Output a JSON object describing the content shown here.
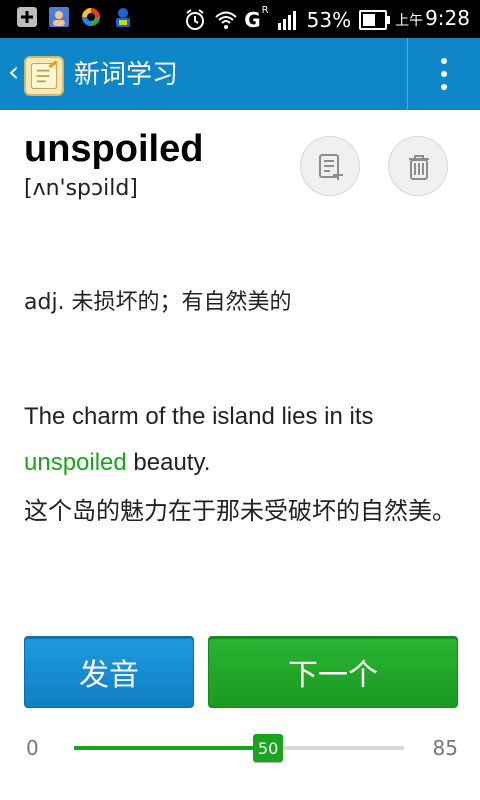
{
  "status_bar": {
    "battery_percent": "53%",
    "time_prefix": "上午",
    "time": "9:28",
    "network": "G",
    "network_sub": "R"
  },
  "app_bar": {
    "title": "新词学习"
  },
  "word": {
    "headword": "unspoiled",
    "phonetic": "[ʌn'spɔild]",
    "definition": "adj. 未损坏的；有自然美的",
    "example": {
      "prefix": "The charm of the island lies in its ",
      "highlight": "unspoiled",
      "suffix": " beauty.",
      "translation": "这个岛的魅力在于那未受破坏的自然美。"
    }
  },
  "actions": {
    "pronounce_label": "发音",
    "next_label": "下一个"
  },
  "slider": {
    "min": "0",
    "max": "85",
    "value": "50"
  },
  "colors": {
    "appbar": "#0f86c8",
    "accent_green": "#19a51f",
    "button_blue": "#1f9be0",
    "button_green": "#2bb432"
  }
}
